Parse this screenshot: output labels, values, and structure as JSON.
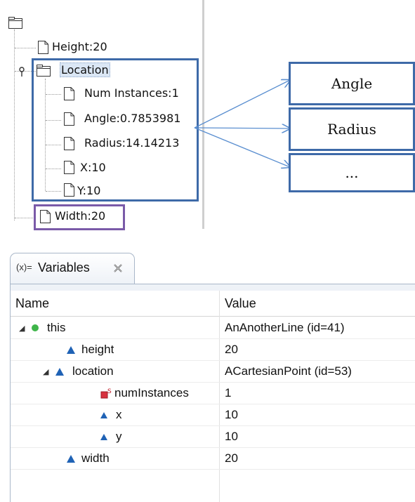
{
  "tree": {
    "items": [
      {
        "label": "Height:20"
      },
      {
        "label": "Location"
      },
      {
        "label": "Num Instances:1"
      },
      {
        "label": "Angle:0.7853981"
      },
      {
        "label": "Radius:14.14213"
      },
      {
        "label": "X:10"
      },
      {
        "label": "Y:10"
      },
      {
        "label": "Width:20"
      }
    ]
  },
  "callouts": [
    {
      "label": "Angle"
    },
    {
      "label": "Radius"
    },
    {
      "label": "..."
    }
  ],
  "colors": {
    "annotation_blue": "#3e6aa8",
    "annotation_purple": "#7a5aa8",
    "arrow_blue": "#5b8fd0"
  },
  "variables_view": {
    "tab_label": "Variables",
    "tab_icon": "(x)=",
    "close_icon": "close-icon",
    "columns": {
      "name": "Name",
      "value": "Value"
    },
    "rows": [
      {
        "name": "this",
        "value": "AnAnotherLine  (id=41)"
      },
      {
        "name": "height",
        "value": "20"
      },
      {
        "name": "location",
        "value": "ACartesianPoint  (id=53)"
      },
      {
        "name": "numInstances",
        "value": "1"
      },
      {
        "name": "x",
        "value": "10"
      },
      {
        "name": "y",
        "value": "10"
      },
      {
        "name": "width",
        "value": "20"
      }
    ]
  }
}
